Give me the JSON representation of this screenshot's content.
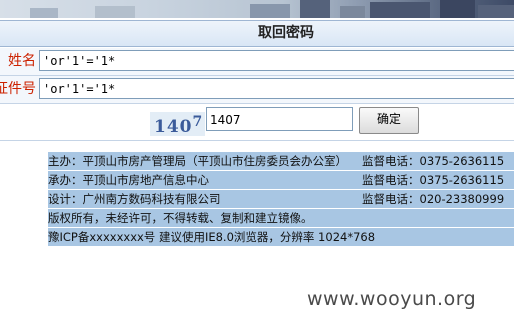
{
  "header": {
    "title": "取回密码"
  },
  "form": {
    "name_label": "姓名",
    "name_value": "'or'1'='1*",
    "id_label": "证件号",
    "id_value": "'or'1'='1*",
    "captcha_text": "140",
    "captcha_sup": "7",
    "code_value": "1407",
    "submit_label": "确定"
  },
  "footer": {
    "rows": [
      {
        "left": "主办：平顶山市房产管理局（平顶山市住房委员会办公室）",
        "right": "监督电话：0375-2636115"
      },
      {
        "left": "承办：平顶山市房地产信息中心",
        "right": "监督电话：0375-2636115"
      },
      {
        "left": "设计：广州南方数码科技有限公司",
        "right": "监督电话：020-23380999"
      },
      {
        "left": "版权所有，未经许可，不得转载、复制和建立镜像。",
        "right": ""
      },
      {
        "left": "豫ICP备xxxxxxxx号 建议使用IE8.0浏览器，分辨率 1024*768",
        "right": ""
      }
    ]
  },
  "watermark": "www.wooyun.org",
  "colors": {
    "label_red": "#cc2200",
    "footer_bg": "#a8c6e3",
    "title_bg": "#d9e6f5"
  }
}
